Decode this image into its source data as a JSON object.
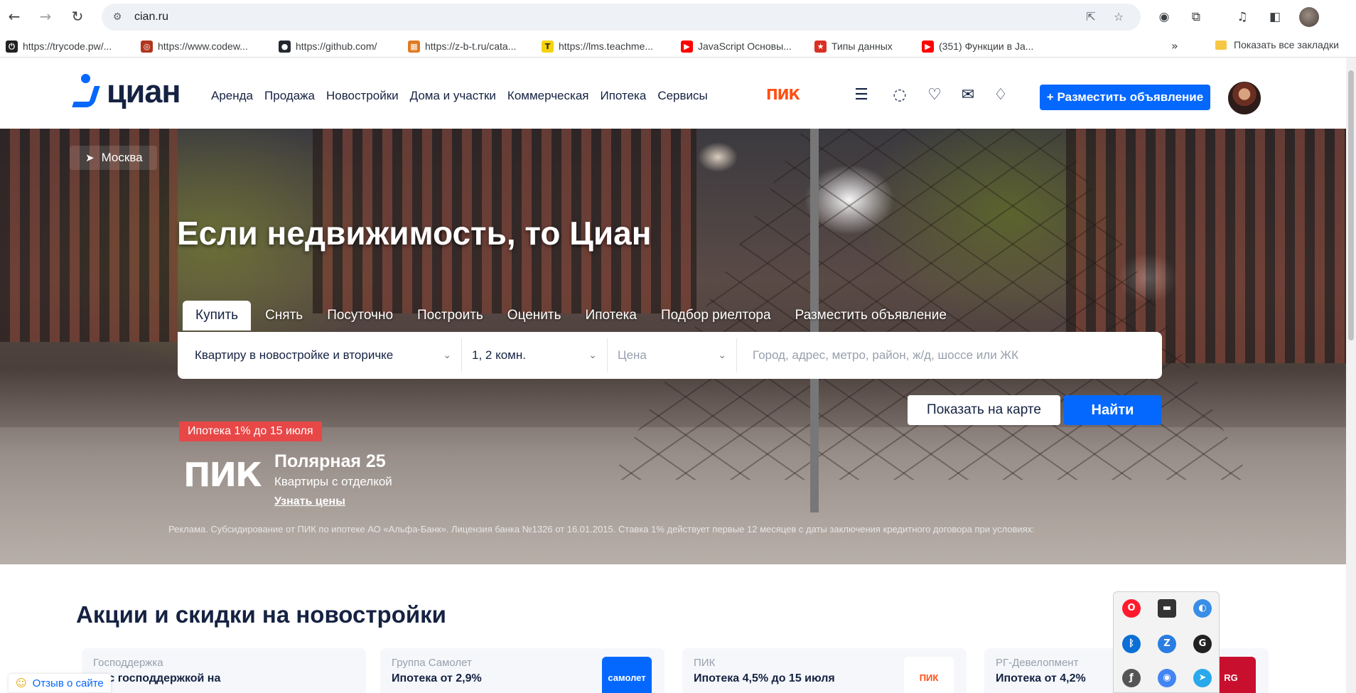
{
  "browser": {
    "url": "cian.ru",
    "bookmarks": [
      {
        "label": "https://trycode.pw/...",
        "icon": "power-icon",
        "color": "#222222",
        "glyph": "⏻"
      },
      {
        "label": "https://www.codew...",
        "icon": "codewars-icon",
        "color": "#b1361e",
        "glyph": "◎"
      },
      {
        "label": "https://github.com/",
        "icon": "github-icon",
        "color": "#24292f",
        "glyph": "●"
      },
      {
        "label": "https://z-b-t.ru/cata...",
        "icon": "grid-icon",
        "color": "#e07a1f",
        "glyph": "▦"
      },
      {
        "label": "https://lms.teachme...",
        "icon": "teachme-icon",
        "color": "#f5d20c",
        "glyph": "T"
      },
      {
        "label": "JavaScript Основы...",
        "icon": "youtube-icon",
        "color": "#ff0000",
        "glyph": "▶"
      },
      {
        "label": "Типы данных",
        "icon": "figure-icon",
        "color": "#d93025",
        "glyph": "★"
      },
      {
        "label": "(351) Функции в Ja...",
        "icon": "youtube-icon",
        "color": "#ff0000",
        "glyph": "▶"
      }
    ],
    "bookmarks_more": "»",
    "all_bookmarks": "Показать все закладки"
  },
  "header": {
    "logo_text": "циан",
    "nav": [
      "Аренда",
      "Продажа",
      "Новостройки",
      "Дома и участки",
      "Коммерческая",
      "Ипотека",
      "Сервисы"
    ],
    "partner_badge": "ПИК",
    "post_button": "+ Разместить объявление"
  },
  "hero": {
    "city": "Москва",
    "title": "Если недвижимость, то Циан",
    "tabs": [
      "Купить",
      "Снять",
      "Посуточно",
      "Построить",
      "Оценить",
      "Ипотека",
      "Подбор риелтора",
      "Разместить объявление"
    ],
    "active_tab": "Купить",
    "search": {
      "property_type": "Квартиру в новостройке и вторичке",
      "rooms": "1, 2 комн.",
      "price_placeholder": "Цена",
      "geo_placeholder": "Город, адрес, метро, район, ж/д, шоссе или ЖК"
    },
    "map_button": "Показать на карте",
    "find_button": "Найти",
    "promo": {
      "badge": "Ипотека 1% до 15 июля",
      "logo": "ПИК",
      "title": "Полярная 25",
      "subtitle": "Квартиры с отделкой",
      "link": "Узнать цены"
    },
    "disclaimer": "Реклама. Субсидирование от ПИК по ипотеке АО «Альфа-Банк». Лицензия банка №1326 от 16.01.2015. Ставка 1% действует первые 12 месяцев с даты заключения кредитного договора при условиях:"
  },
  "promotions": {
    "title": "Акции и скидки на новостройки",
    "cards": [
      {
        "source": "Господдержка",
        "title": "ка с господдержкой на",
        "brand": "",
        "brand_color": "#f5f7fa"
      },
      {
        "source": "Группа Самолет",
        "title": "Ипотека от 2,9%",
        "brand": "самолет",
        "brand_color": "#0468ff"
      },
      {
        "source": "ПИК",
        "title": "Ипотека 4,5% до 15 июля",
        "brand": "ПИК",
        "brand_color": "#ffffff"
      },
      {
        "source": "РГ-Девелопмент",
        "title": "Ипотека от 4,2%",
        "brand": "RG",
        "brand_color": "#c8102e"
      }
    ]
  },
  "feedback": "Отзыв о сайте"
}
